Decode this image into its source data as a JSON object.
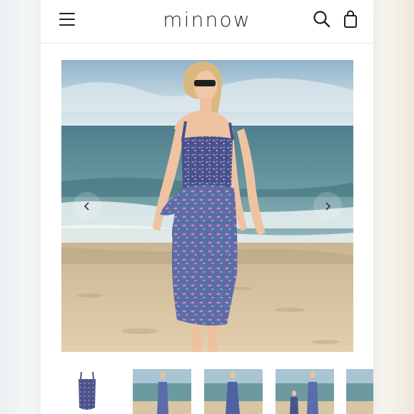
{
  "app": {
    "brand": "minnow"
  },
  "header": {
    "menu_icon": "hamburger-menu-icon",
    "search_icon": "search-icon",
    "cart_icon": "shopping-bag-icon"
  },
  "gallery": {
    "prev_icon": "chevron-left-icon",
    "next_icon": "chevron-right-icon",
    "thumbnail_count": 5
  },
  "colors": {
    "text": "#2b2b2b",
    "swimsuit_navy": "#3f4f8f",
    "print_pink": "#d98ca7",
    "sand": "#d9c4a3",
    "ocean": "#5f8c96",
    "sky": "#9fbed0"
  }
}
